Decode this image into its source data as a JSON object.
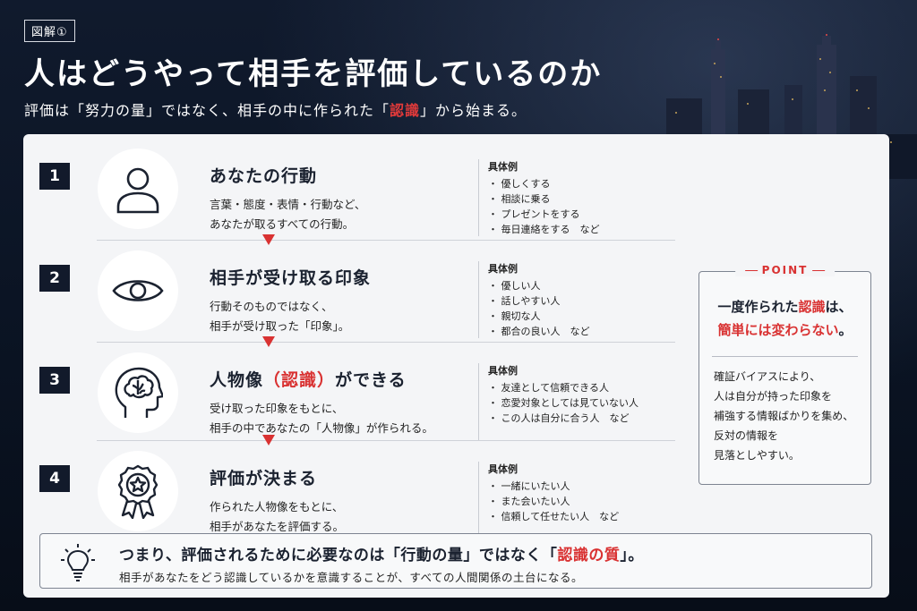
{
  "header": {
    "tag": "図解①",
    "title": "人はどうやって相手を評価しているのか",
    "subtitle_pre": "評価は「努力の量」ではなく、相手の中に作られた「",
    "subtitle_red": "認識",
    "subtitle_post": "」から始まる。"
  },
  "steps": [
    {
      "number": "1",
      "icon": "person-icon",
      "heading": "あなたの行動",
      "desc": [
        "言葉・態度・表情・行動など、",
        "あなたが取るすべての行動。"
      ],
      "examples_title": "具体例",
      "examples": [
        "優しくする",
        "相談に乗る",
        "プレゼントをする",
        "毎日連絡をする　など"
      ]
    },
    {
      "number": "2",
      "icon": "eye-icon",
      "heading": "相手が受け取る印象",
      "desc": [
        "行動そのものではなく、",
        "相手が受け取った「印象」。"
      ],
      "examples_title": "具体例",
      "examples": [
        "優しい人",
        "話しやすい人",
        "親切な人",
        "都合の良い人　など"
      ]
    },
    {
      "number": "3",
      "icon": "brain-head-icon",
      "heading_pre": "人物像",
      "heading_red": "（認識）",
      "heading_post": "ができる",
      "desc": [
        "受け取った印象をもとに、",
        "相手の中であなたの「人物像」が作られる。"
      ],
      "examples_title": "具体例",
      "examples": [
        "友達として信頼できる人",
        "恋愛対象としては見ていない人",
        "この人は自分に合う人　など"
      ]
    },
    {
      "number": "4",
      "icon": "award-ribbon-icon",
      "heading": "評価が決まる",
      "desc": [
        "作られた人物像をもとに、",
        "相手があなたを評価する。"
      ],
      "examples_title": "具体例",
      "examples": [
        "一緒にいたい人",
        "また会いたい人",
        "信頼して任せたい人　など"
      ]
    }
  ],
  "point": {
    "label": "POINT",
    "line1_pre": "一度作られた",
    "line1_red": "認識",
    "line1_post": "は、",
    "line2_red": "簡単には変わらない",
    "line2_post": "。",
    "body": [
      "確証バイアスにより、",
      "人は自分が持った印象を",
      "補強する情報ばかりを集め、",
      "反対の情報を",
      "見落としやすい。"
    ]
  },
  "summary": {
    "icon": "lightbulb-icon",
    "line1_pre": "つまり、評価されるために必要なのは「行動の量」ではなく「",
    "line1_red": "認識の質",
    "line1_post": "」。",
    "line2": "相手があなたをどう認識しているかを意識することが、すべての人間関係の土台になる。"
  },
  "colors": {
    "accent_red": "#d93232",
    "navy": "#121a2b",
    "card_bg": "#f4f5f7"
  }
}
